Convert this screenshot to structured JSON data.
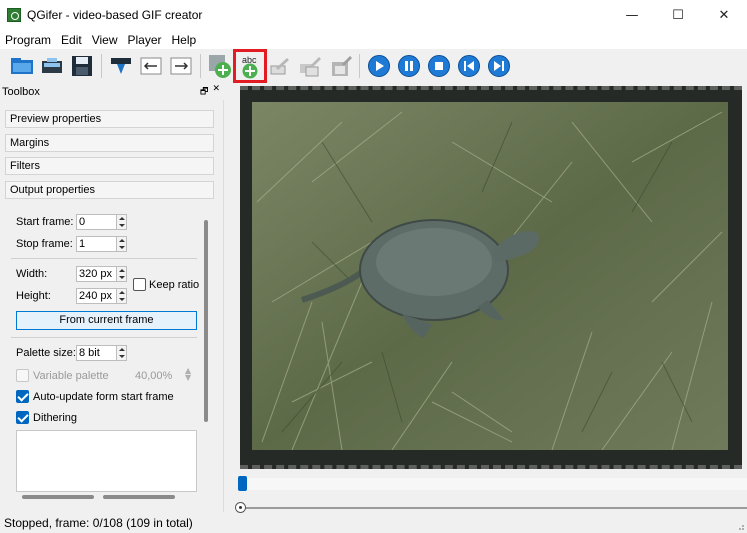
{
  "window": {
    "title": "QGifer - video-based GIF creator",
    "minimize_glyph": "—",
    "maximize_glyph": "☐",
    "close_glyph": "✕"
  },
  "menu": [
    "Program",
    "Edit",
    "View",
    "Player",
    "Help"
  ],
  "toolbar": {
    "buttons": [
      {
        "name": "open-video-icon"
      },
      {
        "name": "extract-icon"
      },
      {
        "name": "save-icon"
      },
      {
        "name": "export-icon"
      },
      {
        "name": "start-frame-icon"
      },
      {
        "name": "stop-frame-icon"
      },
      {
        "name": "add-object-icon"
      },
      {
        "name": "add-text-icon",
        "text": "abc",
        "highlighted": true
      },
      {
        "name": "edit-object-icon"
      },
      {
        "name": "edit-objects-icon"
      },
      {
        "name": "remove-object-icon"
      },
      {
        "name": "play-icon"
      },
      {
        "name": "pause-icon"
      },
      {
        "name": "stop-icon"
      },
      {
        "name": "previous-icon"
      },
      {
        "name": "next-icon"
      }
    ],
    "accent": "#0a6fd1",
    "highlight_color": "#e31b23"
  },
  "toolbox": {
    "title": "Toolbox",
    "float_glyph": "🗗",
    "close_glyph": "✕",
    "sections": [
      "Preview properties",
      "Margins",
      "Filters",
      "Output properties"
    ],
    "start_frame": {
      "label": "Start frame:",
      "value": "0"
    },
    "stop_frame": {
      "label": "Stop frame:",
      "value": "1"
    },
    "width": {
      "label": "Width:",
      "value": "320 px"
    },
    "height": {
      "label": "Height:",
      "value": "240 px"
    },
    "keep_ratio": {
      "label": "Keep ratio",
      "checked": false
    },
    "from_current_frame": "From current frame",
    "palette_size": {
      "label": "Palette size:",
      "value": "8 bit"
    },
    "variable_palette": {
      "label": "Variable palette",
      "value": "40,00%",
      "checked": false,
      "enabled": false
    },
    "auto_update": {
      "label": "Auto-update form start frame",
      "checked": true
    },
    "dithering": {
      "label": "Dithering",
      "checked": true
    }
  },
  "player": {
    "timeline_position": 0,
    "total_frames": 109
  },
  "status": {
    "text": "Stopped, frame: 0/108 (109 in total)"
  }
}
